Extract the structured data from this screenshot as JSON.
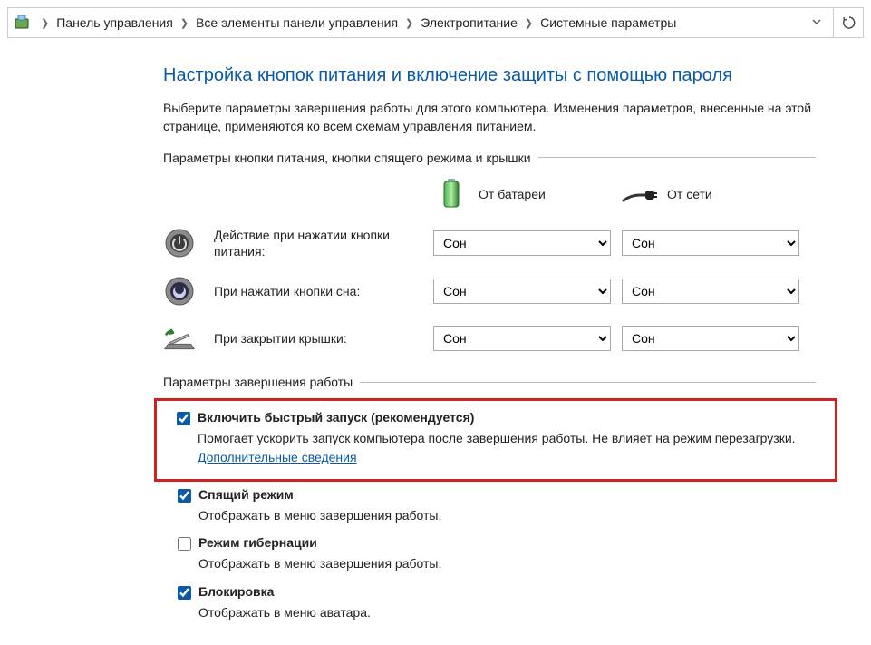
{
  "breadcrumb": {
    "items": [
      "Панель управления",
      "Все элементы панели управления",
      "Электропитание",
      "Системные параметры"
    ]
  },
  "header": {
    "title": "Настройка кнопок питания и включение защиты с помощью пароля",
    "intro": "Выберите параметры завершения работы для этого компьютера. Изменения параметров, внесенные на этой странице, применяются ко всем схемам управления питанием."
  },
  "buttons_section": {
    "label": "Параметры кнопки питания, кнопки спящего режима и крышки",
    "col_battery": "От батареи",
    "col_ac": "От сети",
    "rows": [
      {
        "label": "Действие при нажатии кнопки питания:",
        "battery": "Сон",
        "ac": "Сон"
      },
      {
        "label": "При нажатии кнопки сна:",
        "battery": "Сон",
        "ac": "Сон"
      },
      {
        "label": "При закрытии крышки:",
        "battery": "Сон",
        "ac": "Сон"
      }
    ]
  },
  "shutdown_section": {
    "label": "Параметры завершения работы",
    "options": [
      {
        "title": "Включить быстрый запуск (рекомендуется)",
        "desc_prefix": "Помогает ускорить запуск компьютера после завершения работы. Не влияет на режим перезагрузки. ",
        "link": "Дополнительные сведения",
        "checked": true,
        "highlighted": true
      },
      {
        "title": "Спящий режим",
        "desc": "Отображать в меню завершения работы.",
        "checked": true
      },
      {
        "title": "Режим гибернации",
        "desc": "Отображать в меню завершения работы.",
        "checked": false
      },
      {
        "title": "Блокировка",
        "desc": "Отображать в меню аватара.",
        "checked": true
      }
    ]
  }
}
